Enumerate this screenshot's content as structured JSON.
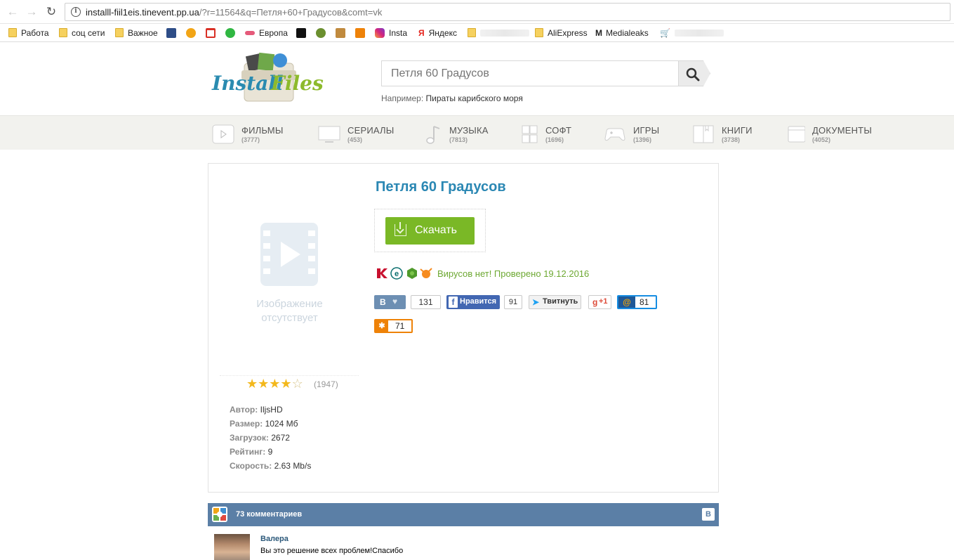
{
  "browser": {
    "url_host": "installl-fiil1eis.tinevent.pp.ua",
    "url_path": "/?r=11564&q=Петля+60+Градусов&comt=vk",
    "bookmarks": [
      {
        "label": "Работа",
        "icon": "folder-icon"
      },
      {
        "label": "соц сети",
        "icon": "folder-icon"
      },
      {
        "label": "Важное",
        "icon": "folder-icon"
      },
      {
        "label": "Европа",
        "icon": "europa-icon"
      },
      {
        "label": "Insta",
        "icon": "instagram-icon"
      },
      {
        "label": "Яндекс",
        "icon": "yandex-icon"
      },
      {
        "label": "AliExpress",
        "icon": "folder-icon"
      },
      {
        "label": "Medialeaks",
        "icon": "medialeaks-icon"
      }
    ]
  },
  "search": {
    "placeholder": "Петля 60 Градусов",
    "hint_prefix": "Например:",
    "hint_example": "Пираты карибского моря"
  },
  "categories": [
    {
      "label": "ФИЛЬМЫ",
      "count": "(3777)",
      "icon": "play-icon"
    },
    {
      "label": "СЕРИАЛЫ",
      "count": "(453)",
      "icon": "tv-icon"
    },
    {
      "label": "МУЗЫКА",
      "count": "(7813)",
      "icon": "music-note-icon"
    },
    {
      "label": "СОФТ",
      "count": "(1696)",
      "icon": "windows-icon"
    },
    {
      "label": "ИГРЫ",
      "count": "(1396)",
      "icon": "gamepad-icon"
    },
    {
      "label": "КНИГИ",
      "count": "(3738)",
      "icon": "book-icon"
    },
    {
      "label": "ДОКУМЕНТЫ",
      "count": "(4052)",
      "icon": "folder-doc-icon"
    }
  ],
  "item": {
    "title": "Петля 60 Градусов",
    "no_image_text": "Изображение отсутствует",
    "rating_stars": 4,
    "rating_max": 5,
    "votes": "(1947)",
    "download_label": "Скачать",
    "virus_text": "Вирусов нет! Проверено 19.12.2016",
    "meta": [
      {
        "key": "Автор:",
        "value": "IljsHD"
      },
      {
        "key": "Размер:",
        "value": "1024 Мб"
      },
      {
        "key": "Загрузок:",
        "value": "2672"
      },
      {
        "key": "Рейтинг:",
        "value": "9"
      },
      {
        "key": "Скорость:",
        "value": "2.63 Mb/s"
      }
    ]
  },
  "share": {
    "vk_letter": "В",
    "vk_count": "131",
    "fb_label": "Нравится",
    "fb_count": "91",
    "tw_label": "Твитнуть",
    "gplus_label": "+1",
    "mail_count": "81",
    "ok_count": "71"
  },
  "comments": {
    "title": "73 комментариев",
    "vk_badge": "В",
    "first_author": "Валера",
    "first_text": "Вы это решение всех проблем!Спасибо"
  },
  "colors": {
    "accent": "#2a87b3",
    "download_green": "#7ab826",
    "vk_blue": "#5b7fa6",
    "virus_green": "#6da832"
  }
}
